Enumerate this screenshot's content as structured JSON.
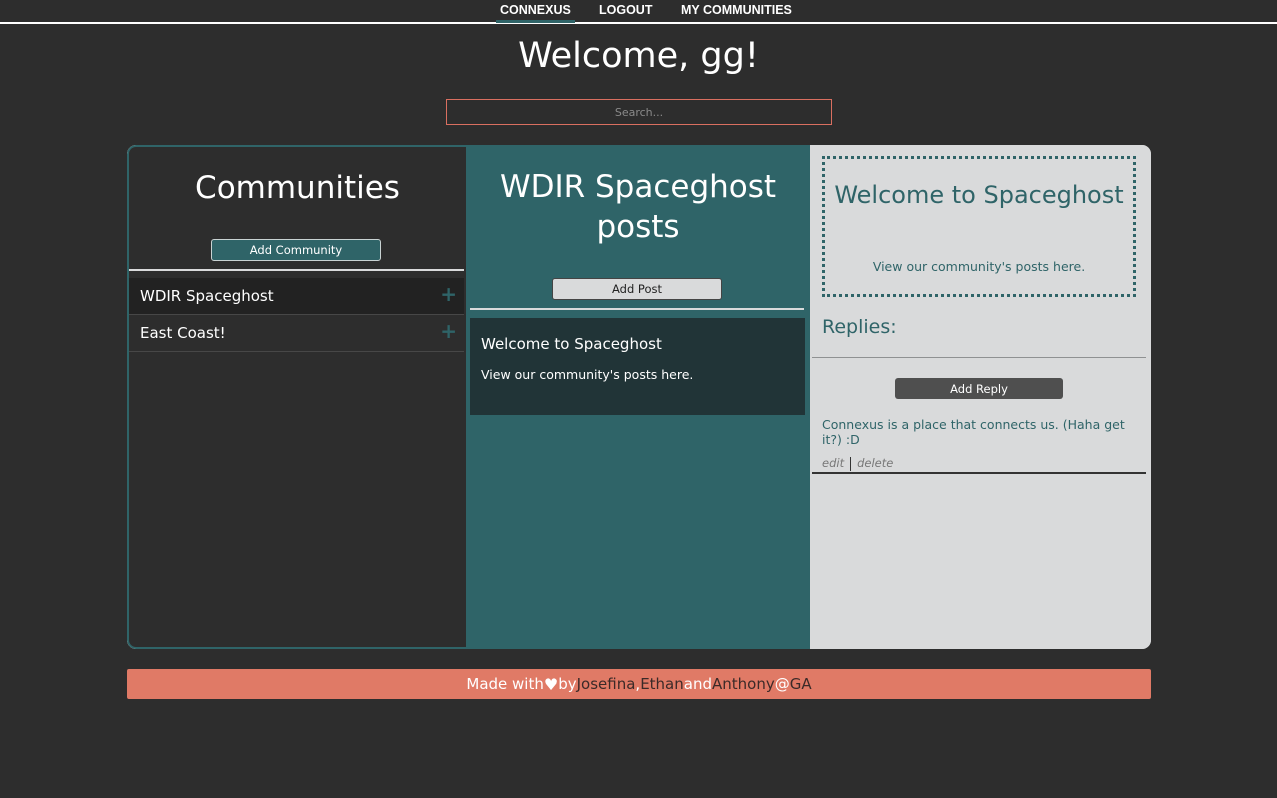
{
  "nav": {
    "items": [
      {
        "label": "CONNEXUS"
      },
      {
        "label": "LOGOUT"
      },
      {
        "label": "MY COMMUNITIES"
      }
    ]
  },
  "header": {
    "welcome": "Welcome, gg!",
    "search_placeholder": "Search..."
  },
  "communities": {
    "title": "Communities",
    "add_label": "Add Community",
    "items": [
      {
        "name": "WDIR Spaceghost",
        "icon": "plus-icon"
      },
      {
        "name": "East Coast!",
        "icon": "plus-icon"
      }
    ]
  },
  "posts": {
    "title": "WDIR Spaceghost posts",
    "add_label": "Add Post",
    "items": [
      {
        "title": "Welcome to Spaceghost",
        "body": "View our community's posts here."
      }
    ]
  },
  "detail": {
    "title": "Welcome to Spaceghost",
    "body": "View our community's posts here.",
    "replies_label": "Replies:",
    "add_reply_label": "Add Reply",
    "replies": [
      {
        "text": "Connexus is a place that connects us. (Haha get it?) :D",
        "edit_label": "edit",
        "delete_label": "delete"
      }
    ]
  },
  "footer": {
    "made_with": "Made with",
    "by": "by",
    "names": [
      "Josefina",
      "Ethan",
      "Anthony"
    ],
    "comma": ",",
    "and": "and",
    "at": "@",
    "org": "GA",
    "heart_icon": "heart-icon"
  },
  "colors": {
    "background": "#2d2d2d",
    "teal": "#2f6468",
    "light_panel": "#d9dadb",
    "footer": "#e07a66"
  }
}
